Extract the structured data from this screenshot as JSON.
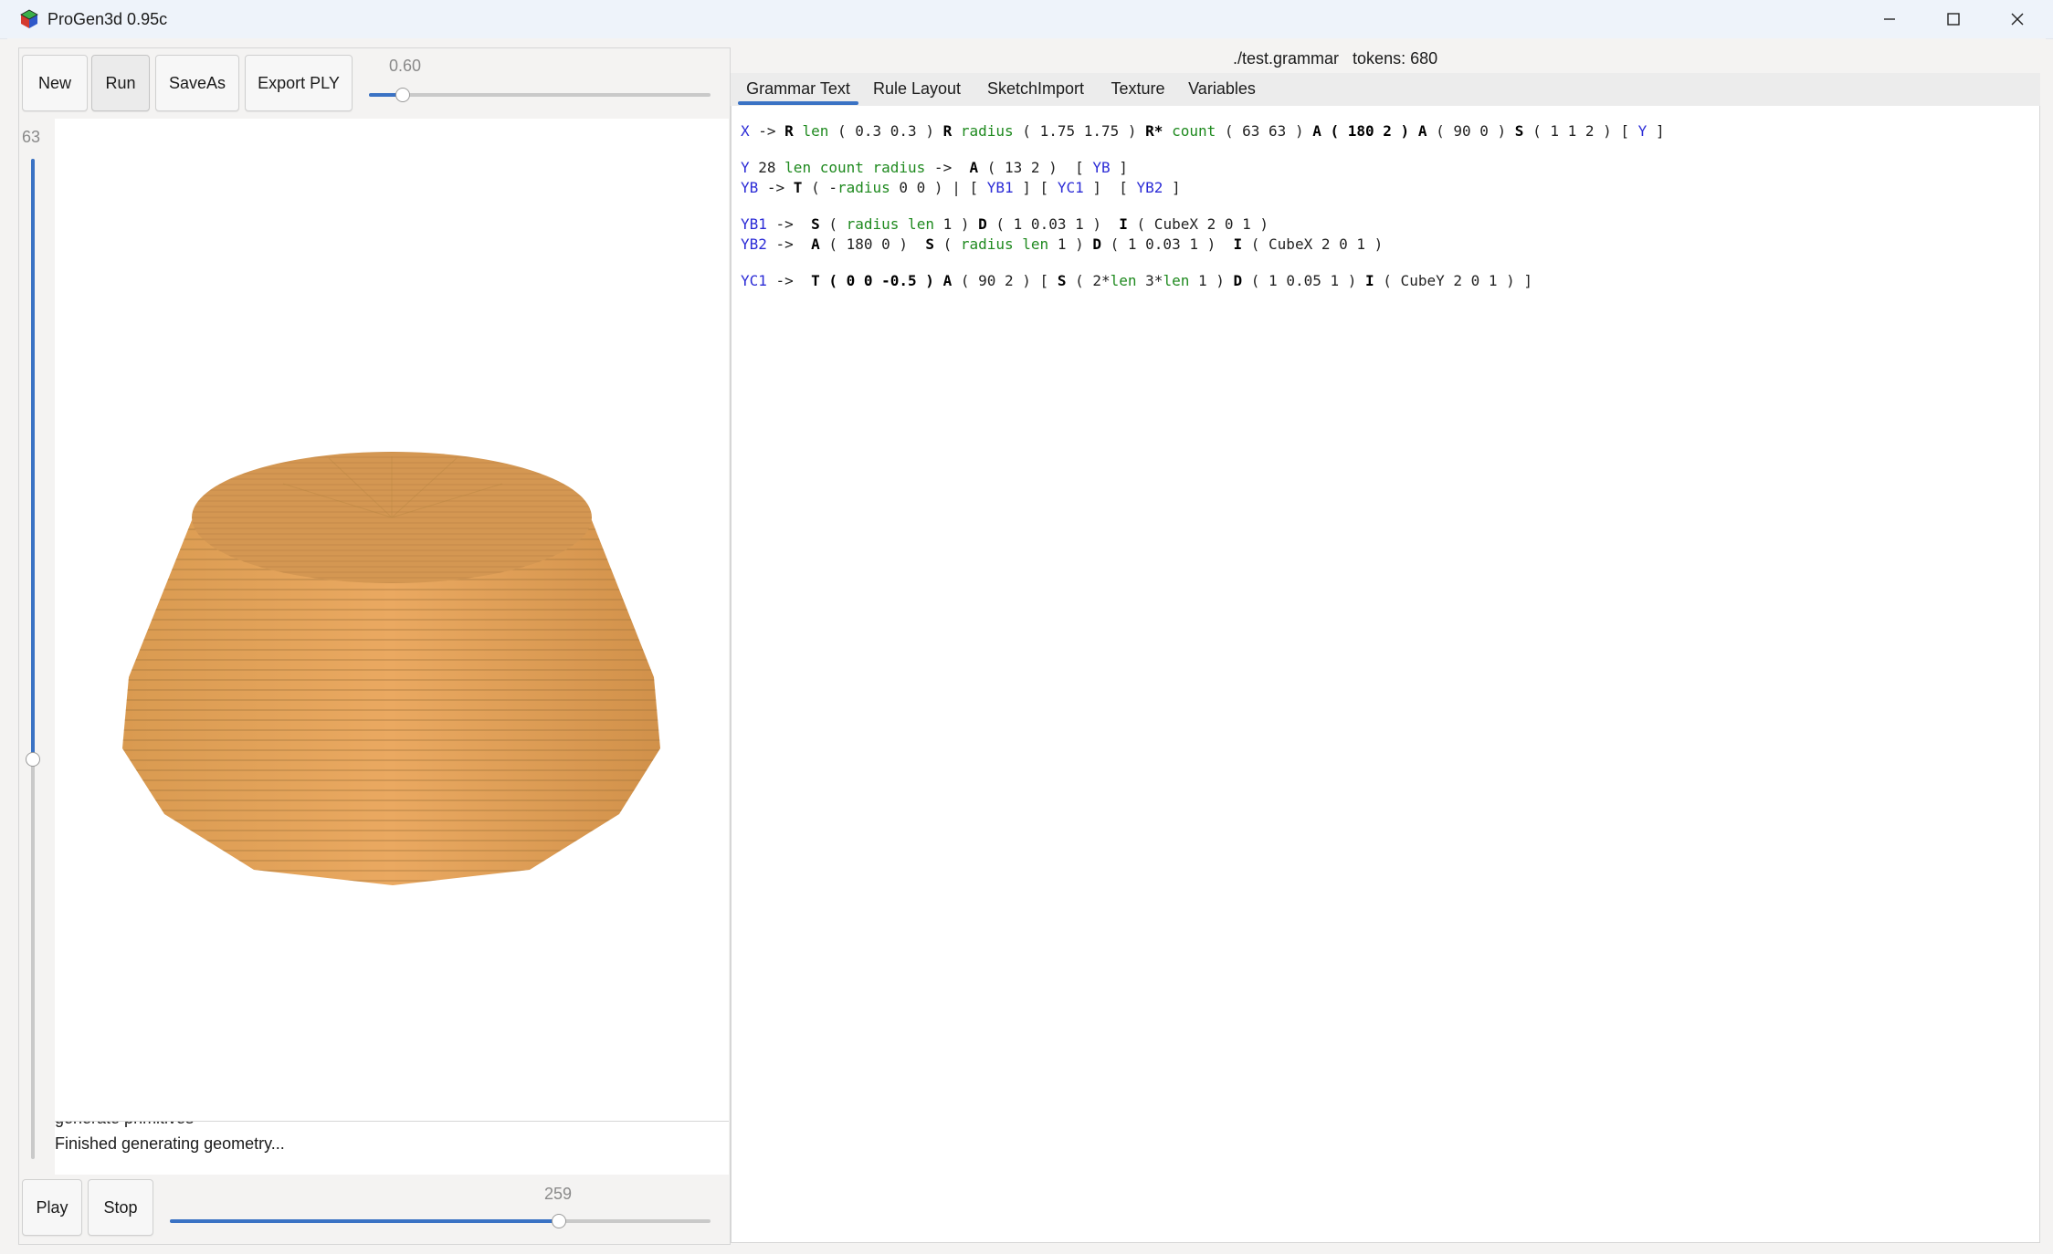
{
  "window": {
    "title": "ProGen3d 0.95c",
    "controls": [
      "minimize-icon",
      "maximize-icon",
      "close-icon"
    ]
  },
  "toolbar": {
    "new_label": "New",
    "run_label": "Run",
    "saveas_label": "SaveAs",
    "export_label": "Export PLY",
    "slider_value_text": "0.60",
    "slider_fraction": 0.1
  },
  "vertical_slider": {
    "value_text": "63",
    "fraction": 0.4
  },
  "viewport": {
    "object": "tapered-cylinder-render",
    "colors": {
      "top": "#d69a54",
      "side": "#e2a25a",
      "stripe": "#b98546"
    }
  },
  "log": {
    "lines": [
      "generate primitives",
      "Finished generating geometry..."
    ]
  },
  "playback": {
    "play_label": "Play",
    "stop_label": "Stop",
    "slider_value_text": "259",
    "slider_fraction": 0.72
  },
  "file_info": {
    "path": "./test.grammar",
    "tokens": "tokens: 680"
  },
  "tabs": [
    {
      "label": "Grammar Text",
      "active": true
    },
    {
      "label": "Rule Layout"
    },
    {
      "label": "SketchImport"
    },
    {
      "label": "Texture"
    },
    {
      "label": "Variables"
    }
  ],
  "grammar": {
    "line1": [
      {
        "t": "X",
        "c": "nt"
      },
      {
        "t": " -> "
      },
      {
        "t": "R",
        "c": "kw"
      },
      {
        "t": " "
      },
      {
        "t": "len",
        "c": "var"
      },
      {
        "t": " ( 0.3 0.3 ) "
      },
      {
        "t": "R",
        "c": "kw"
      },
      {
        "t": " "
      },
      {
        "t": "radius",
        "c": "var"
      },
      {
        "t": " ( 1.75 1.75 ) "
      },
      {
        "t": "R*",
        "c": "kw"
      },
      {
        "t": " "
      },
      {
        "t": "count",
        "c": "var"
      },
      {
        "t": " ( 63 63 ) "
      },
      {
        "t": "A ( 180 2 )",
        "c": "kw"
      },
      {
        "t": " "
      },
      {
        "t": "A",
        "c": "kw"
      },
      {
        "t": " ( 90 0 ) "
      },
      {
        "t": "S",
        "c": "kw"
      },
      {
        "t": " ( 1 1 2 ) [ "
      },
      {
        "t": "Y",
        "c": "nt"
      },
      {
        "t": " ]"
      }
    ],
    "line2": [
      {
        "t": "Y",
        "c": "nt"
      },
      {
        "t": " 28 "
      },
      {
        "t": "len count radius",
        "c": "var"
      },
      {
        "t": " ->  "
      },
      {
        "t": "A",
        "c": "kw"
      },
      {
        "t": " ( 13 2 )  [ "
      },
      {
        "t": "YB",
        "c": "nt"
      },
      {
        "t": " ]"
      }
    ],
    "line3": [
      {
        "t": "YB",
        "c": "nt"
      },
      {
        "t": " -> "
      },
      {
        "t": "T",
        "c": "kw"
      },
      {
        "t": " ( -"
      },
      {
        "t": "radius",
        "c": "var"
      },
      {
        "t": " 0 0 ) | [ "
      },
      {
        "t": "YB1",
        "c": "nt"
      },
      {
        "t": " ] [ "
      },
      {
        "t": "YC1",
        "c": "nt"
      },
      {
        "t": " ]  [ "
      },
      {
        "t": "YB2",
        "c": "nt"
      },
      {
        "t": " ]"
      }
    ],
    "line4": [
      {
        "t": "YB1",
        "c": "nt"
      },
      {
        "t": " ->  "
      },
      {
        "t": "S",
        "c": "kw"
      },
      {
        "t": " ( "
      },
      {
        "t": "radius len",
        "c": "var"
      },
      {
        "t": " 1 ) "
      },
      {
        "t": "D",
        "c": "kw"
      },
      {
        "t": " ( 1 0.03 1 )  "
      },
      {
        "t": "I",
        "c": "kw"
      },
      {
        "t": " ( CubeX 2 0 1 )"
      }
    ],
    "line5": [
      {
        "t": "YB2",
        "c": "nt"
      },
      {
        "t": " ->  "
      },
      {
        "t": "A",
        "c": "kw"
      },
      {
        "t": " ( 180 0 )  "
      },
      {
        "t": "S",
        "c": "kw"
      },
      {
        "t": " ( "
      },
      {
        "t": "radius len",
        "c": "var"
      },
      {
        "t": " 1 ) "
      },
      {
        "t": "D",
        "c": "kw"
      },
      {
        "t": " ( 1 0.03 1 )  "
      },
      {
        "t": "I",
        "c": "kw"
      },
      {
        "t": " ( CubeX 2 0 1 )"
      }
    ],
    "line6": [
      {
        "t": "YC1",
        "c": "nt"
      },
      {
        "t": " ->  "
      },
      {
        "t": "T ( 0 0 -0.5 )",
        "c": "kw"
      },
      {
        "t": " "
      },
      {
        "t": "A",
        "c": "kw"
      },
      {
        "t": " ( 90 2 ) [ "
      },
      {
        "t": "S",
        "c": "kw"
      },
      {
        "t": " ( 2*"
      },
      {
        "t": "len",
        "c": "var"
      },
      {
        "t": " 3*"
      },
      {
        "t": "len",
        "c": "var"
      },
      {
        "t": " 1 ) "
      },
      {
        "t": "D",
        "c": "kw"
      },
      {
        "t": " ( 1 0.05 1 ) "
      },
      {
        "t": "I",
        "c": "kw"
      },
      {
        "t": " ( CubeY 2 0 1 ) ]"
      }
    ]
  }
}
